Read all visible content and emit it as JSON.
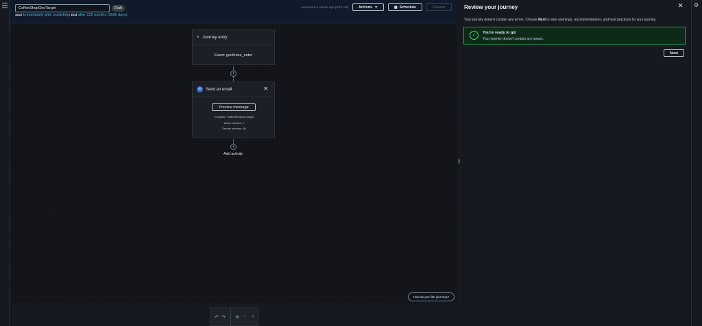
{
  "journey": {
    "name": "CoffeeShopGeoTarget",
    "status": "Draft",
    "start_label": "Start",
    "start_value": "Immediately after publishing",
    "end_label": "End",
    "end_value": "after 120 months (3600 days)",
    "autosave": "Autosaved a minute ago (9:54 AM)"
  },
  "toolbar": {
    "actions_label": "Actions",
    "schedule_label": "Schedule",
    "review_label": "Review"
  },
  "canvas": {
    "entry_node": {
      "title": "Journey entry",
      "event": "Event: geofence_enter"
    },
    "email_node": {
      "title": "Send an email",
      "preview_label": "Preview message",
      "template": "Template: CoffeeShopGeoTarget",
      "version": "Active Version: 1",
      "sender": "Sender address:",
      "sender_value": "@"
    },
    "add_activity_label": "Add activity",
    "feedback_label": "How do you like journeys?"
  },
  "zoom_toolbar": {
    "undo_icon": "undo-icon",
    "redo_icon": "redo-icon",
    "fit_icon": "fit-view-icon",
    "zoom_out_icon": "zoom-out-icon",
    "zoom_in_icon": "zoom-in-icon"
  },
  "review_panel": {
    "title": "Review your journey",
    "desc_before": "Your journey doesn't contain any errors. Choose ",
    "desc_bold": "Next",
    "desc_after": " to view warnings, recommendations, and best practices for your journey.",
    "alert_title": "You're ready to go!",
    "alert_body": "Your journey doesn't contain any issues.",
    "next_label": "Next"
  },
  "colors": {
    "accent_link": "#4cb8d9",
    "success": "#4ade80",
    "email_icon": "#2f6fd6"
  }
}
